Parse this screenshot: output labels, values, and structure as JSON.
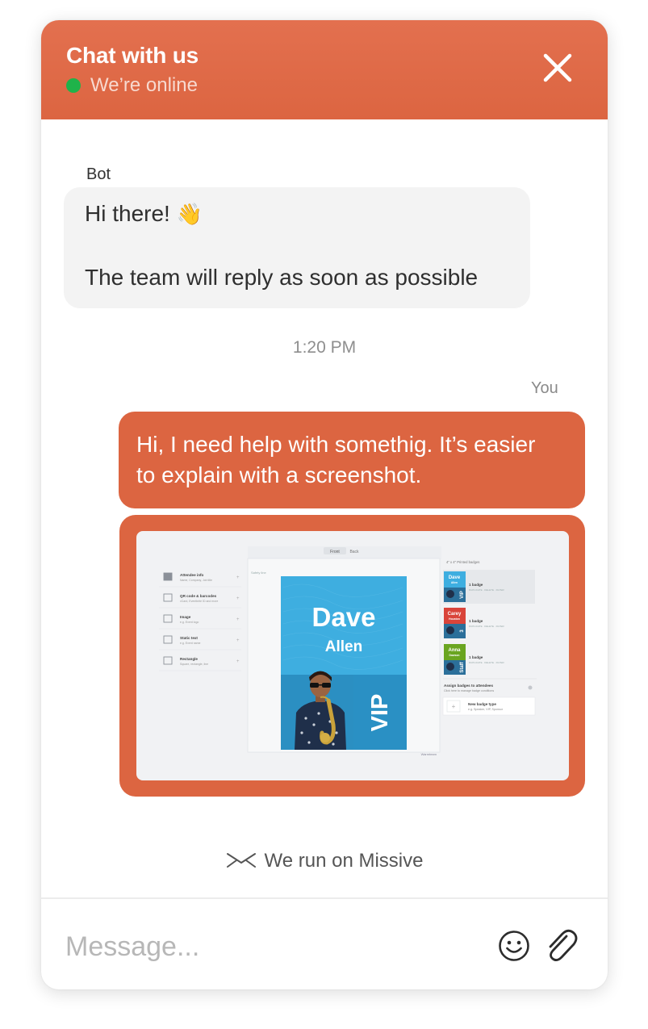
{
  "header": {
    "title": "Chat with us",
    "status": "We’re online",
    "status_color": "#1fb34a",
    "brand_color": "#dc6541",
    "close_icon": "close-icon"
  },
  "messages": {
    "bot": {
      "sender": "Bot",
      "line1": "Hi there!",
      "emoji": "👋",
      "line2": "The team will reply as soon as possible"
    },
    "timestamp": "1:20 PM",
    "user": {
      "sender": "You",
      "line1": "Hi, I need help with somethig. It’s easier",
      "line2": "to explain with a screenshot."
    }
  },
  "attachment": {
    "tabs": [
      "Front",
      "Back"
    ],
    "safety_label": "Safety line",
    "side_items": [
      {
        "title": "Attendee info",
        "sub": "Name, Company, Job title",
        "icon": "person-icon"
      },
      {
        "title": "QR code & barcodes",
        "sub": "vCard, Eventbrite ID and more",
        "icon": "qr-icon"
      },
      {
        "title": "Image",
        "sub": "e.g. Event logo",
        "icon": "image-icon"
      },
      {
        "title": "Static text",
        "sub": "e.g. Event name",
        "icon": "text-icon"
      },
      {
        "title": "Rectangle",
        "sub": "Square, rectangle, line",
        "icon": "rectangle-icon"
      }
    ],
    "badge": {
      "first": "Dave",
      "last": "Allen",
      "tag": "VIP"
    },
    "right_header": "4\" x 4\" Printed badges",
    "badge_types": [
      {
        "name_top": "Dave",
        "name_bottom": "Allen",
        "tag": "VIP",
        "title": "1 badge",
        "sub": "DUPLICATE · DELETE · FILTER",
        "color": "#3eaee0"
      },
      {
        "name_top": "Carey",
        "name_bottom": "Houston",
        "tag": "3",
        "title": "1 badge",
        "sub": "DUPLICATE · DELETE · FILTER",
        "color": "#d9443a"
      },
      {
        "name_top": "Anna",
        "name_bottom": "Dawson",
        "tag": "Staff",
        "title": "1 badge",
        "sub": "DUPLICATE · DELETE · FILTER",
        "color": "#6aa520"
      }
    ],
    "assign_title": "Assign badges to attendees",
    "assign_sub": "Click here to manage badge conditions",
    "new_badge_title": "New badge type",
    "new_badge_sub": "e.g. Speaker, VIP, Sponsor",
    "corner_label": "Warmteam"
  },
  "footer": {
    "powered": "We run on Missive",
    "icon": "missive-icon"
  },
  "composer": {
    "placeholder": "Message...",
    "emoji_icon": "smiley-icon",
    "attach_icon": "paperclip-icon"
  }
}
